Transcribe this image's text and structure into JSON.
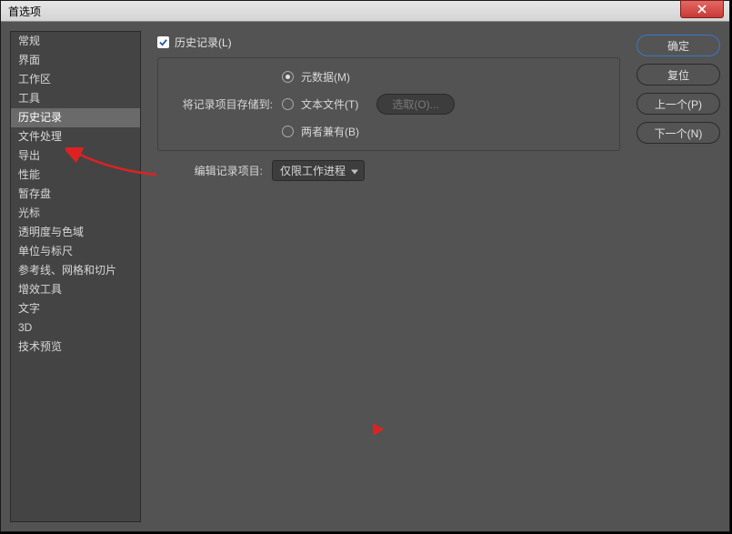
{
  "window": {
    "title": "首选项",
    "close_icon": "×"
  },
  "sidebar": {
    "items": [
      {
        "label": "常规"
      },
      {
        "label": "界面"
      },
      {
        "label": "工作区"
      },
      {
        "label": "工具"
      },
      {
        "label": "历史记录",
        "selected": true
      },
      {
        "label": "文件处理"
      },
      {
        "label": "导出"
      },
      {
        "label": "性能"
      },
      {
        "label": "暂存盘"
      },
      {
        "label": "光标"
      },
      {
        "label": "透明度与色域"
      },
      {
        "label": "单位与标尺"
      },
      {
        "label": "参考线、网格和切片"
      },
      {
        "label": "增效工具"
      },
      {
        "label": "文字"
      },
      {
        "label": "3D"
      },
      {
        "label": "技术预览"
      }
    ]
  },
  "main": {
    "checkbox_label": "历史记录(L)",
    "save_to_label": "将记录项目存储到:",
    "radios": [
      {
        "label": "元数据(M)",
        "selected": true
      },
      {
        "label": "文本文件(T)",
        "selected": false
      },
      {
        "label": "两者兼有(B)",
        "selected": false
      }
    ],
    "choose_btn": "选取(O)...",
    "edit_label": "编辑记录项目:",
    "dropdown_value": "仅限工作进程"
  },
  "buttons": {
    "ok": "确定",
    "reset": "复位",
    "prev": "上一个(P)",
    "next": "下一个(N)"
  }
}
